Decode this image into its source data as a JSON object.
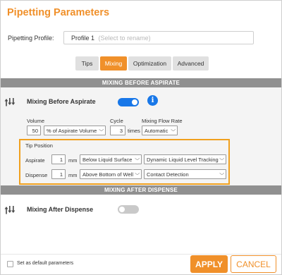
{
  "dialog": {
    "title": "Pipetting Parameters"
  },
  "profile": {
    "label": "Pipetting Profile:",
    "value": "Profile 1",
    "hint": "(Select to rename)"
  },
  "tabs": [
    {
      "label": "Tips",
      "active": false
    },
    {
      "label": "Mixing",
      "active": true
    },
    {
      "label": "Optimization",
      "active": false
    },
    {
      "label": "Advanced",
      "active": false
    }
  ],
  "mixing_before": {
    "section_title": "MIXING BEFORE ASPIRATE",
    "row_title": "Mixing Before Aspirate",
    "enabled": true,
    "info_glyph": "i",
    "volume": {
      "label": "Volume",
      "value": "50",
      "unit": "% of Aspirate Volume"
    },
    "cycle": {
      "label": "Cycle",
      "value": "3",
      "unit": "times"
    },
    "flow_rate": {
      "label": "Mixing Flow Rate",
      "value": "Automatic"
    },
    "tip_position": {
      "title": "Tip Position",
      "aspirate": {
        "label": "Aspirate",
        "value": "1",
        "unit": "mm",
        "reference": "Below Liquid Surface",
        "tracking": "Dynamic Liquid Level Tracking"
      },
      "dispense": {
        "label": "Dispense",
        "value": "1",
        "unit": "mm",
        "reference": "Above Bottom of Well",
        "tracking": "Contact Detection"
      }
    }
  },
  "mixing_after": {
    "section_title": "MIXING AFTER DISPENSE",
    "row_title": "Mixing After Dispense",
    "enabled": false
  },
  "footer": {
    "default_label": "Set as default parameters",
    "default_checked": false,
    "apply_label": "APPLY",
    "cancel_label": "CANCEL"
  },
  "colors": {
    "accent": "#f0902a",
    "toggle_on": "#1877e8",
    "section_bar": "#909090",
    "highlight_border": "#f0a01e"
  },
  "icons": {
    "flow": "pipette-flow-icon",
    "info": "info-icon",
    "dropdown": "chevron-down-icon"
  }
}
